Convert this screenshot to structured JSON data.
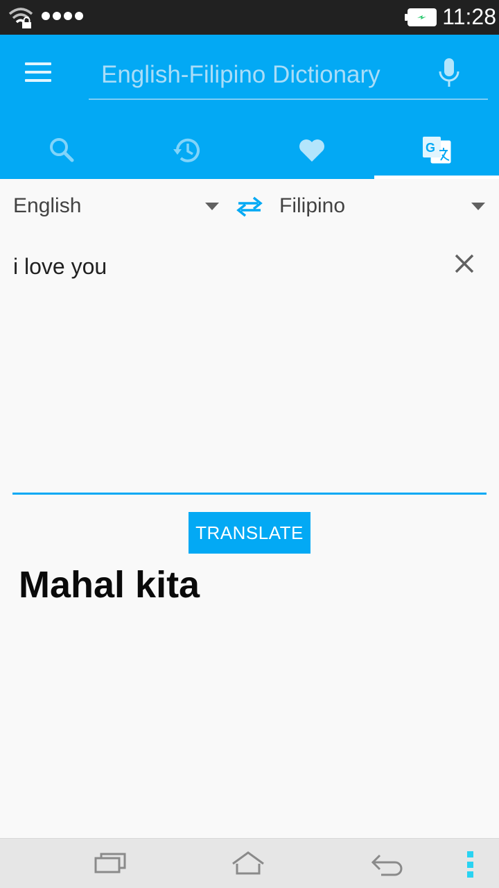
{
  "status_bar": {
    "time": "11:28",
    "icons": [
      "wifi-lock-icon",
      "signal-dots-icon",
      "battery-charging-icon"
    ]
  },
  "app_bar": {
    "menu_icon": "menu-icon",
    "search_placeholder": "English-Filipino Dictionary",
    "mic_icon": "mic-icon",
    "tabs": [
      {
        "name": "search",
        "icon": "search-icon",
        "active": false
      },
      {
        "name": "history",
        "icon": "history-icon",
        "active": false
      },
      {
        "name": "favorites",
        "icon": "heart-icon",
        "active": false
      },
      {
        "name": "translate",
        "icon": "google-translate-icon",
        "active": true
      }
    ]
  },
  "translator": {
    "source_language": "English",
    "target_language": "Filipino",
    "input_text": "i love you",
    "translate_label": "TRANSLATE",
    "result_text": "Mahal kita"
  },
  "colors": {
    "primary": "#03a9f4",
    "status_bar": "#212121",
    "background": "#f9f9f9",
    "nav_accent": "#29d3f2"
  }
}
